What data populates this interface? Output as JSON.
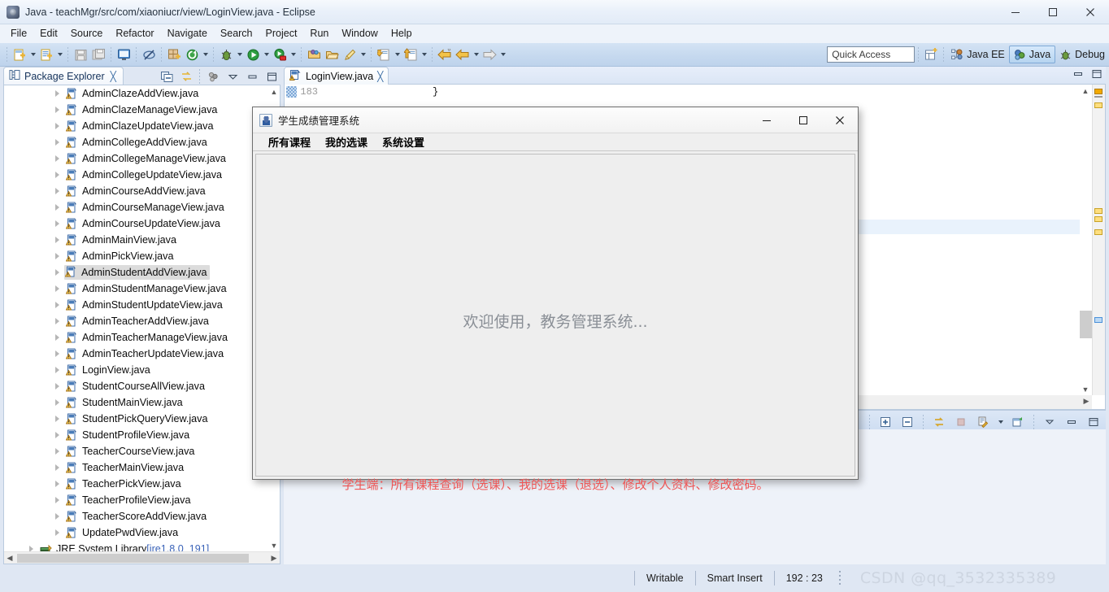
{
  "window": {
    "title": "Java - teachMgr/src/com/xiaoniucr/view/LoginView.java - Eclipse",
    "app_icon": "eclipse-icon",
    "minimize": "minimize-icon",
    "maximize": "maximize-icon",
    "close": "close-icon"
  },
  "menubar": {
    "items": [
      "File",
      "Edit",
      "Source",
      "Refactor",
      "Navigate",
      "Search",
      "Project",
      "Run",
      "Window",
      "Help"
    ]
  },
  "toolbar": {
    "quick_access_placeholder": "Quick Access",
    "buttons": [
      "new-wizard-icon",
      "new-java-class-icon",
      "save-icon",
      "save-all-icon",
      "open-console-icon",
      "toggle-annotation-icon",
      "new-package-icon",
      "refresh-icon",
      "debug-icon",
      "run-icon",
      "coverage-icon",
      "open-type-icon",
      "open-folder-icon",
      "marker-icon",
      "next-annotation-icon",
      "previous-annotation-icon",
      "back-icon",
      "forward-icon"
    ],
    "perspectives": [
      {
        "label": "Java EE",
        "icon": "java-ee-perspective-icon",
        "active": false
      },
      {
        "label": "Java",
        "icon": "java-perspective-icon",
        "active": true
      },
      {
        "label": "Debug",
        "icon": "debug-perspective-icon",
        "active": false
      }
    ]
  },
  "package_explorer": {
    "tab_label": "Package Explorer",
    "tab_icon": "package-explorer-icon",
    "close_icon": "close-tab-icon",
    "toolbar": [
      "collapse-all-icon",
      "link-with-editor-icon",
      "view-menu-filter-icon",
      "view-menu-icon",
      "minimize-icon",
      "maximize-icon"
    ],
    "items": [
      {
        "label": "AdminClazeAddView.java",
        "icon": "java-file-warning-icon",
        "selected": false
      },
      {
        "label": "AdminClazeManageView.java",
        "icon": "java-file-warning-icon",
        "selected": false
      },
      {
        "label": "AdminClazeUpdateView.java",
        "icon": "java-file-warning-icon",
        "selected": false
      },
      {
        "label": "AdminCollegeAddView.java",
        "icon": "java-file-warning-icon",
        "selected": false
      },
      {
        "label": "AdminCollegeManageView.java",
        "icon": "java-file-warning-icon",
        "selected": false
      },
      {
        "label": "AdminCollegeUpdateView.java",
        "icon": "java-file-warning-icon",
        "selected": false
      },
      {
        "label": "AdminCourseAddView.java",
        "icon": "java-file-warning-icon",
        "selected": false
      },
      {
        "label": "AdminCourseManageView.java",
        "icon": "java-file-warning-icon",
        "selected": false
      },
      {
        "label": "AdminCourseUpdateView.java",
        "icon": "java-file-warning-icon",
        "selected": false
      },
      {
        "label": "AdminMainView.java",
        "icon": "java-file-warning-icon",
        "selected": false
      },
      {
        "label": "AdminPickView.java",
        "icon": "java-file-warning-icon",
        "selected": false
      },
      {
        "label": "AdminStudentAddView.java",
        "icon": "java-file-warning-icon",
        "selected": true
      },
      {
        "label": "AdminStudentManageView.java",
        "icon": "java-file-warning-icon",
        "selected": false
      },
      {
        "label": "AdminStudentUpdateView.java",
        "icon": "java-file-warning-icon",
        "selected": false
      },
      {
        "label": "AdminTeacherAddView.java",
        "icon": "java-file-warning-icon",
        "selected": false
      },
      {
        "label": "AdminTeacherManageView.java",
        "icon": "java-file-warning-icon",
        "selected": false
      },
      {
        "label": "AdminTeacherUpdateView.java",
        "icon": "java-file-warning-icon",
        "selected": false
      },
      {
        "label": "LoginView.java",
        "icon": "java-file-warning-icon",
        "selected": false
      },
      {
        "label": "StudentCourseAllView.java",
        "icon": "java-file-warning-icon",
        "selected": false
      },
      {
        "label": "StudentMainView.java",
        "icon": "java-file-warning-icon",
        "selected": false
      },
      {
        "label": "StudentPickQueryView.java",
        "icon": "java-file-warning-icon",
        "selected": false
      },
      {
        "label": "StudentProfileView.java",
        "icon": "java-file-warning-icon",
        "selected": false
      },
      {
        "label": "TeacherCourseView.java",
        "icon": "java-file-warning-icon",
        "selected": false
      },
      {
        "label": "TeacherMainView.java",
        "icon": "java-file-warning-icon",
        "selected": false
      },
      {
        "label": "TeacherPickView.java",
        "icon": "java-file-warning-icon",
        "selected": false
      },
      {
        "label": "TeacherProfileView.java",
        "icon": "java-file-warning-icon",
        "selected": false
      },
      {
        "label": "TeacherScoreAddView.java",
        "icon": "java-file-warning-icon",
        "selected": false
      },
      {
        "label": "UpdatePwdView.java",
        "icon": "java-file-warning-icon",
        "selected": false
      }
    ],
    "jre_entry": {
      "label": "JRE System Library",
      "detail": "[jre1.8.0_191]",
      "icon": "jre-library-icon"
    }
  },
  "editor": {
    "tab_label": "LoginView.java",
    "tab_icon": "java-file-warning-icon",
    "close_icon": "close-tab-icon",
    "line_number": "183",
    "code_text": "}",
    "minimize": "minimize-icon",
    "maximize": "maximize-icon"
  },
  "bottom_view": {
    "tools": [
      "terminate-icon",
      "remove-all-terminated-icon",
      "expand-icon",
      "collapse-icon",
      "link-icon",
      "stop-icon",
      "console-options-icon",
      "dropdown-icon",
      "new-console-icon",
      "view-menu-icon",
      "minimize-icon",
      "maximize-icon"
    ]
  },
  "statusbar": {
    "writable": "Writable",
    "insert_mode": "Smart Insert",
    "position": "192 : 23",
    "watermark": "CSDN @qq_3532335389"
  },
  "dialog": {
    "title": "学生成绩管理系统",
    "icon": "java-coffee-cup-icon",
    "minimize": "minimize-icon",
    "maximize": "maximize-icon",
    "close": "close-icon",
    "menu": [
      "所有课程",
      "我的选课",
      "系统设置"
    ],
    "welcome_text": "欢迎使用，教务管理系统...",
    "note_text": "学生端：所有课程查询（选课）、我的选课（退选）、修改个人资料、修改密码。",
    "welcome_color": "#8a8f96",
    "note_color": "#ee5656"
  }
}
